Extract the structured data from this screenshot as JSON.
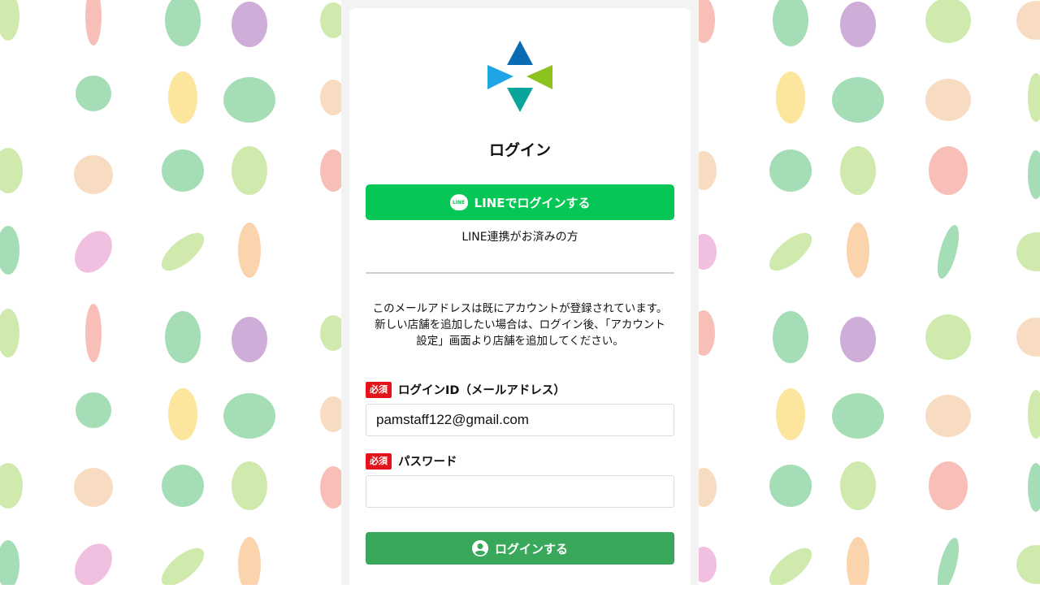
{
  "page": {
    "title": "ログイン",
    "line_button_label": "LINEでログインする",
    "line_icon_text": "LINE",
    "line_note": "LINE連携がお済みの方",
    "notice_lines": [
      "このメールアドレスは既にアカウントが登録されています。",
      "新しい店舗を追加したい場合は、ログイン後、「アカウント",
      "設定」画面より店舗を追加してください。"
    ]
  },
  "form": {
    "required_badge": "必須",
    "login_id_label": "ログインID（メールアドレス）",
    "login_id_value": "pamstaff122@gmail.com",
    "password_label": "パスワード",
    "password_value": "",
    "submit_label": "ログインする"
  },
  "colors": {
    "line_green": "#06c755",
    "submit_green": "#3aa85a",
    "required_red": "#e1151b"
  },
  "icons": [
    "brand-logo-icon",
    "line-icon",
    "user-circle-icon"
  ]
}
